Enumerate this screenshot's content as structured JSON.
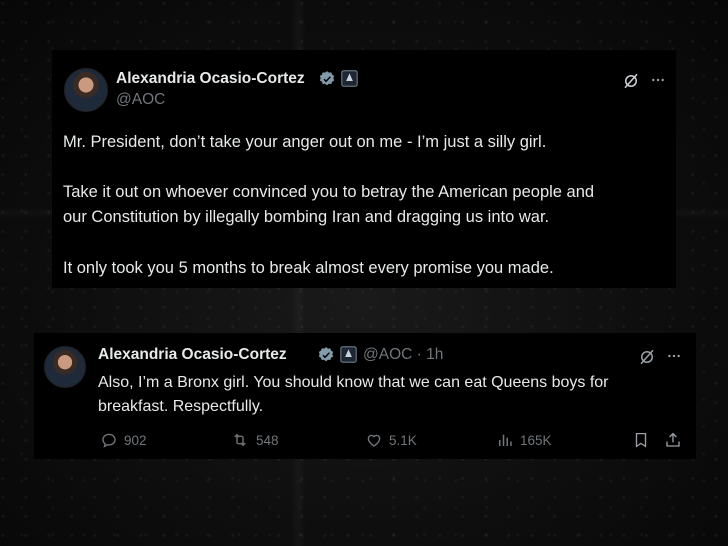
{
  "first_post": {
    "author_name": "Alexandria Ocasio-Cortez",
    "author_handle": "@AOC",
    "paragraph_1": "Mr. President, don’t take your anger out on me - I’m just a silly girl.",
    "paragraph_2_line_1": "Take it out on whoever convinced you to betray the American people and",
    "paragraph_2_line_2": "our Constitution by illegally bombing Iran and dragging us into war.",
    "paragraph_3": "It only took you 5 months to break almost every promise you made."
  },
  "reply_post": {
    "author_name": "Alexandria Ocasio-Cortez",
    "author_handle_time": "@AOC · 1h",
    "text_line_1": "Also, I’m a Bronx girl. You should know that we can eat Queens boys for",
    "text_line_2": "breakfast. Respectfully.",
    "metrics": {
      "replies": "902",
      "reposts": "548",
      "likes": "5.1K",
      "views": "165K"
    }
  },
  "icons": [
    "verified-badge-icon",
    "government-badge-icon",
    "grok-icon",
    "more-icon",
    "reply-icon",
    "repost-icon",
    "like-icon",
    "views-icon",
    "bookmark-icon",
    "share-icon"
  ],
  "colors": {
    "background": "#0b0b0b",
    "card": "#000000",
    "text": "#e7e9ea",
    "muted": "#71767b",
    "verified": "#829aab"
  }
}
